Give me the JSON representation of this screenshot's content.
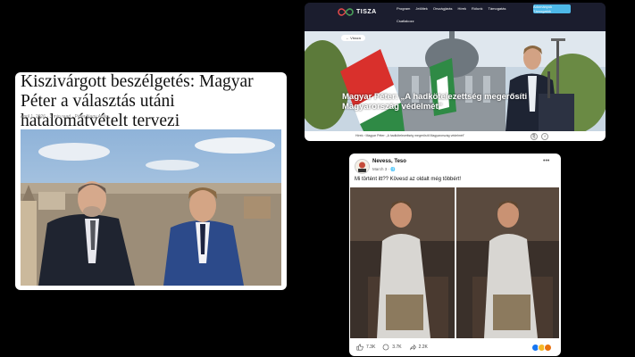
{
  "article": {
    "title": "Kiszivárgott beszélgetés: Magyar Péter a választás utáni hatalomátvételt tervezi",
    "meta": "April 1, 2026 · 3 min read · Péter Nagy Attila"
  },
  "tisza": {
    "logo_text": "TISZA",
    "nav": [
      "Program",
      "Jelöltek",
      "Országjárás",
      "Hírek",
      "Rólunk",
      "Támogatás"
    ],
    "nav2": "Csatlakozz",
    "cta": "Adományok Támogatók",
    "back_label": "← Vissza",
    "headline": "Magyar Péter: „A hadkötelezettség megerősíti Magyarország védelmét\"",
    "breadcrumb": "Hírek › Magyar Péter: „A hadkötelezettség megerősíti Magyarország védelmét\""
  },
  "fb": {
    "name": "Nevess, Teso",
    "date": "March 3 · 🌐",
    "more": "•••",
    "caption": "Mi történt itt?? Kövesd az oldalt még többért!",
    "likes": "7.3K",
    "comments": "3.7K",
    "shares": "2.2K"
  },
  "colors": {
    "tisza_bg": "#1b1d2e",
    "tisza_cta": "#4db8e8",
    "fb_like": "#1877f2"
  }
}
